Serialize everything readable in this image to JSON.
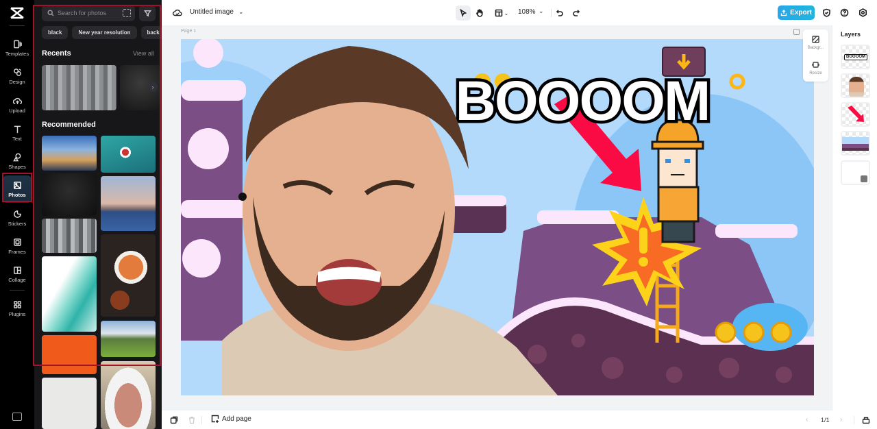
{
  "rail": {
    "items": [
      {
        "label": "Templates",
        "icon": "templates-icon"
      },
      {
        "label": "Design",
        "icon": "design-icon"
      },
      {
        "label": "Upload",
        "icon": "upload-icon"
      },
      {
        "label": "Text",
        "icon": "text-icon"
      },
      {
        "label": "Shapes",
        "icon": "shapes-icon"
      },
      {
        "label": "Photos",
        "icon": "photos-icon",
        "active": true
      },
      {
        "label": "Stickers",
        "icon": "stickers-icon"
      },
      {
        "label": "Frames",
        "icon": "frames-icon"
      },
      {
        "label": "Collage",
        "icon": "collage-icon"
      },
      {
        "label": "Plugins",
        "icon": "plugins-icon"
      }
    ]
  },
  "panel": {
    "search_placeholder": "Search for photos",
    "chips": [
      "black",
      "New year resolution",
      "back"
    ],
    "recents_title": "Recents",
    "view_all": "View all",
    "recommended_title": "Recommended"
  },
  "topbar": {
    "doc_title": "Untitled image",
    "zoom": "108%",
    "export_label": "Export",
    "accent": "#1fb0e3"
  },
  "workspace": {
    "page_label": "Page 1",
    "float_tools": [
      {
        "label": "Backgr...",
        "icon": "background-icon"
      },
      {
        "label": "Resize",
        "icon": "resize-icon"
      }
    ],
    "canvas_text": "BOOOOM"
  },
  "layers": {
    "title": "Layers",
    "items": [
      "BOOOOM text",
      "Man photo",
      "Red arrow",
      "Game background",
      "Blank layer"
    ]
  },
  "bottombar": {
    "add_page": "Add page",
    "pager": "1/1"
  }
}
